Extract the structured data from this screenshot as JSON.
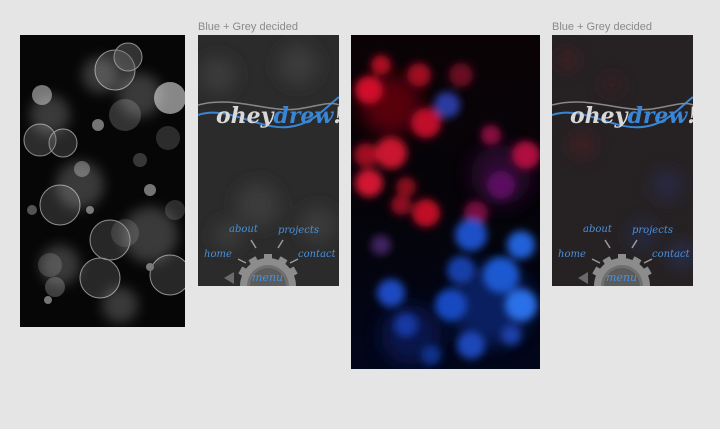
{
  "artboards": [
    {
      "id": "grey-bokeh",
      "label": ""
    },
    {
      "id": "grey-mockup",
      "label": "Blue + Grey decided"
    },
    {
      "id": "redblue-bokeh",
      "label": ""
    },
    {
      "id": "redblue-mockup",
      "label": "Blue + Grey decided"
    }
  ],
  "logo": {
    "part1": "ohey",
    "part2": "drew",
    "part3": "!"
  },
  "menu": {
    "about": "about",
    "projects": "projects",
    "home": "home",
    "contact": "contact",
    "center": "menu"
  },
  "colors": {
    "canvas": "#e5e5e5",
    "accent_blue": "#3a86d6",
    "logo_grey": "#d8d8d8",
    "menu_label_blue": "#4a90d9",
    "gear_grey": "#8c8c8c",
    "mockup_bg": "#2a2a2a"
  }
}
